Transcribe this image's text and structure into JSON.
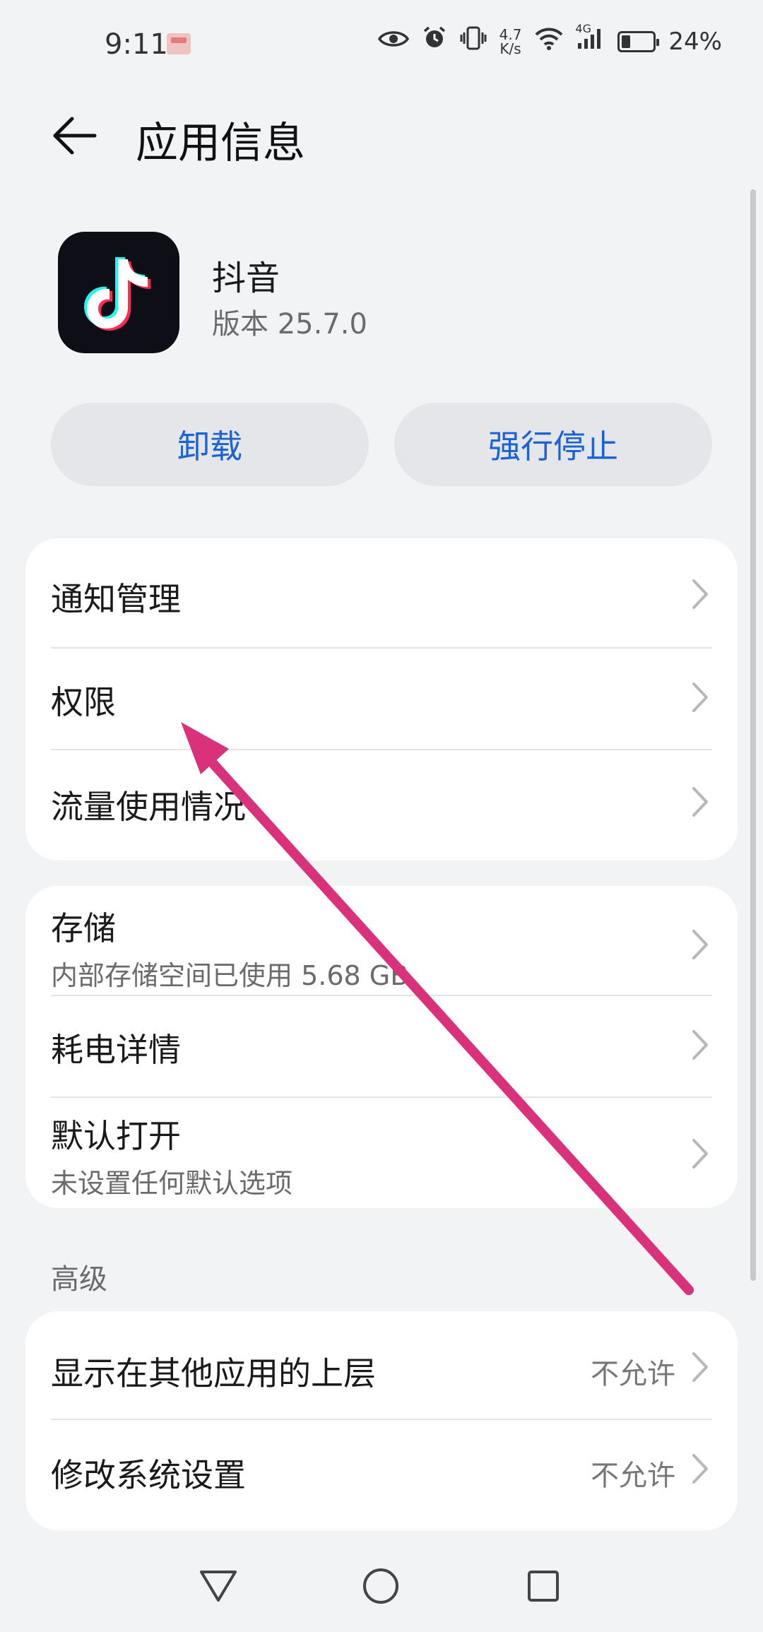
{
  "status_bar": {
    "time": "9:11",
    "speed_top": "4.7",
    "speed_bottom": "K/s",
    "network": "4G",
    "battery_pct": "24%"
  },
  "header": {
    "title": "应用信息"
  },
  "app": {
    "name": "抖音",
    "version": "版本 25.7.0",
    "icon": "tiktok-logo"
  },
  "actions": {
    "uninstall": "卸载",
    "force_stop": "强行停止"
  },
  "card1": {
    "items": [
      {
        "title": "通知管理"
      },
      {
        "title": "权限"
      },
      {
        "title": "流量使用情况"
      }
    ]
  },
  "card2": {
    "items": [
      {
        "title": "存储",
        "sub": "内部存储空间已使用 5.68 GB"
      },
      {
        "title": "耗电详情"
      },
      {
        "title": "默认打开",
        "sub": "未设置任何默认选项"
      }
    ]
  },
  "section_advanced": "高级",
  "card3": {
    "items": [
      {
        "title": "显示在其他应用的上层",
        "value": "不允许"
      },
      {
        "title": "修改系统设置",
        "value": "不允许"
      }
    ]
  },
  "colors": {
    "accent": "#1a62d6",
    "annotation": "#d9317a",
    "background": "#f1f3f5"
  },
  "navbar": {
    "icons": [
      "back-triangle-icon",
      "home-circle-icon",
      "recents-square-icon"
    ]
  }
}
